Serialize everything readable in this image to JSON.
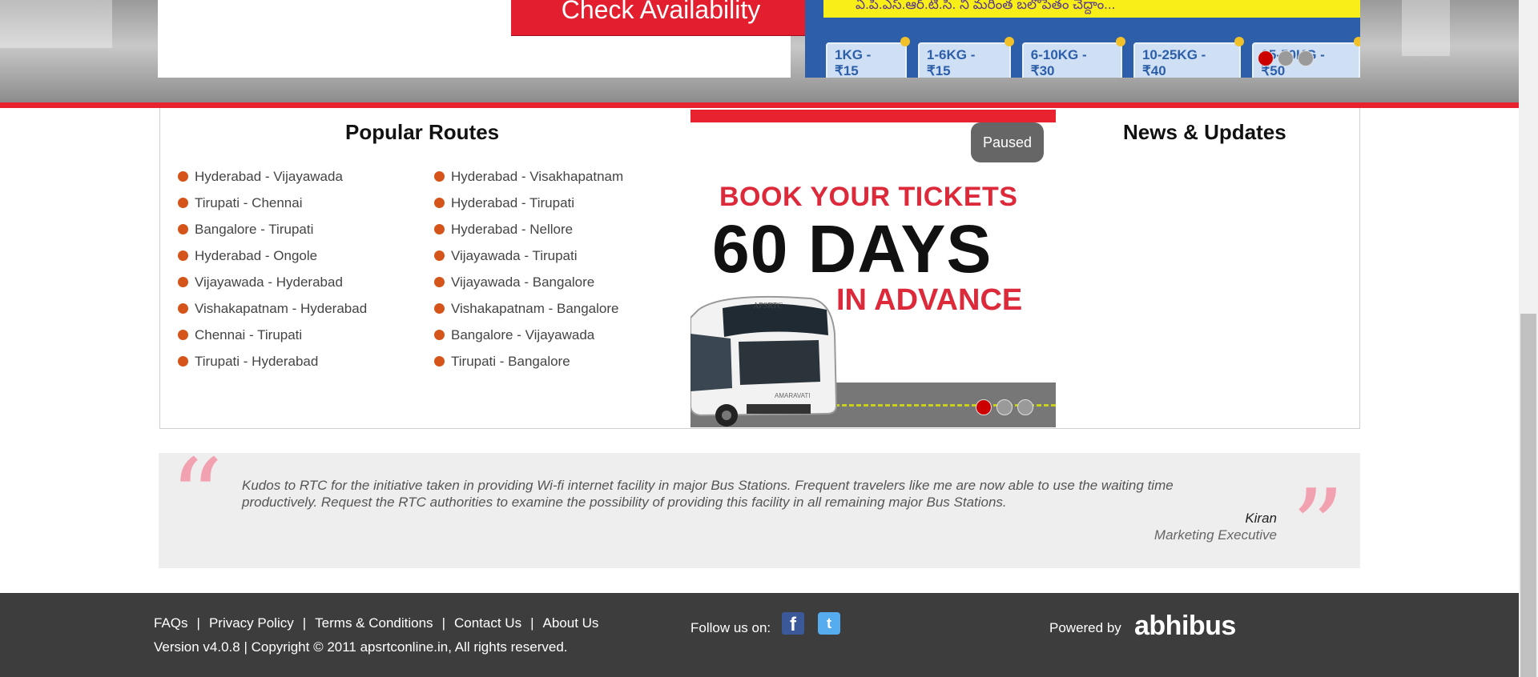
{
  "hero": {
    "check_label": "Check Availability",
    "promo_text": "ఏ.పి.ఎస్.ఆర్.టి.సి. ని మరింత బలోపేతం చేద్దాం...",
    "promo_tags": [
      "1KG - ₹15",
      "1-6KG - ₹15",
      "6-10KG - ₹30",
      "10-25KG - ₹40",
      "25-50KG - ₹50"
    ],
    "promo_dot_active": 0,
    "promo_dot_count": 3
  },
  "routes": {
    "title": "Popular Routes",
    "left": [
      "Hyderabad - Vijayawada",
      "Tirupati - Chennai",
      "Bangalore - Tirupati",
      "Hyderabad - Ongole",
      "Vijayawada - Hyderabad",
      "Vishakapatnam - Hyderabad",
      "Chennai - Tirupati",
      "Tirupati - Hyderabad"
    ],
    "right": [
      "Hyderabad - Visakhapatnam",
      "Hyderabad - Tirupati",
      "Hyderabad - Nellore",
      "Vijayawada - Tirupati",
      "Vijayawada - Bangalore",
      "Vishakapatnam - Bangalore",
      "Bangalore - Vijayawada",
      "Tirupati - Bangalore"
    ]
  },
  "banner": {
    "paused_label": "Paused",
    "line1": "BOOK YOUR TICKETS",
    "line2": "60 DAYS",
    "line3": "IN ADVANCE",
    "bus_text": "APSRTC",
    "bus_name": "AMARAVATI",
    "dot_active": 0,
    "dot_count": 3
  },
  "news": {
    "title": "News & Updates"
  },
  "testimonial": {
    "text": "Kudos to RTC for the initiative taken in providing Wi-fi internet facility in major Bus Stations. Frequent travelers like me are now able to use the waiting time productively. Request the RTC authorities to examine the possibility of providing this facility in all remaining major Bus Stations.",
    "name": "Kiran",
    "role": "Marketing Executive"
  },
  "footer": {
    "links": [
      "FAQs",
      "Privacy Policy",
      "Terms & Conditions",
      "Contact Us",
      "About Us"
    ],
    "copyright": "Version v4.0.8 | Copyright © 2011 apsrtconline.in, All rights reserved.",
    "follow_label": "Follow us on:",
    "facebook_glyph": "f",
    "twitter_glyph": "t",
    "powered_label": "Powered by",
    "brand": "abhibus"
  },
  "colors": {
    "accent_red": "#e8232f",
    "bullet": "#d4541a",
    "footer_bg": "#3d3d3d",
    "quote_pink": "#f2a1b1"
  }
}
